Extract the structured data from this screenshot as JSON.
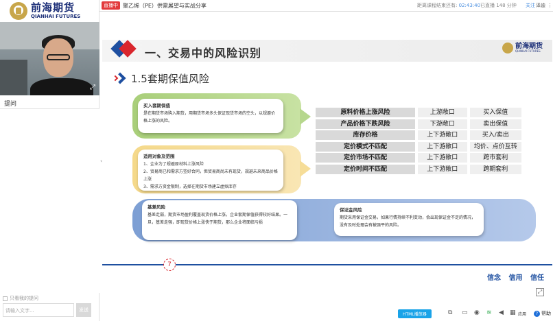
{
  "brand": {
    "cn": "前海期货",
    "en": "QIANHAI FUTURES"
  },
  "left_panel": {
    "ask_tab": "提问",
    "only_mine": "只看我的提问",
    "input_placeholder": "请输入文字...",
    "send": "发送"
  },
  "topbar": {
    "live_badge": "直播中",
    "course_title": "聚乙烯（PE）供需展望与实战分享",
    "countdown_label": "距离课程结束还有:",
    "countdown_time": "02:43:40",
    "played": "已直播 148 分钟",
    "follow": "关注",
    "user": "泽迪"
  },
  "slide": {
    "section_title": "一、交易中的风险识别",
    "subtitle": "1.5套期保值风险",
    "logo": {
      "cn": "前海期货",
      "en": "QIANHAI FUTURES"
    },
    "callout1": {
      "heading": "买入套期保值",
      "body": "是在期货市场购入期货，用期货市场多头保证现货市场的空头，以规避价格上涨的风险。"
    },
    "callout2": {
      "heading": "适用对象及范围",
      "lines": [
        "1、企业为了规避原材料上涨风险",
        "2、贸易商已和需求方签好合同，但贸易商尚未有现货，规避未来商品价格上涨",
        "3、需求方资金限制，选择在期货市场建立虚拟库存"
      ]
    },
    "callout3": {
      "heading": "基差风险",
      "body": "基差走弱，期货市场盈利覆盖现货价格上涨，企业套期保值获得较好结果。一旦，基差走强，即现货价格上涨快于期货，那么企业将面临亏损"
    },
    "callout4": {
      "heading": "保证金风险",
      "body": "期货采用保证金交易，如果行情持续不利变动，会出现保证金不足的情况，没有及时处理会有被强平的风险。"
    },
    "risk_rows": [
      {
        "name": "原料价格上涨风险",
        "exposure": "上游敞口",
        "strategy": "买入保值"
      },
      {
        "name": "产品价格下跌风险",
        "exposure": "下游敞口",
        "strategy": "卖出保值"
      },
      {
        "name": "库存价格",
        "exposure": "上下游敞口",
        "strategy": "买入/卖出"
      },
      {
        "name": "定价模式不匹配",
        "exposure": "上下游敞口",
        "strategy": "均价、点价互转"
      },
      {
        "name": "定价市场不匹配",
        "exposure": "上下游敞口",
        "strategy": "跨市套利"
      },
      {
        "name": "定价时间不匹配",
        "exposure": "上下游敞口",
        "strategy": "跨期套利"
      }
    ],
    "page_number": "7",
    "motto": "信念 信用 信任"
  },
  "bottombar": {
    "html_player": "HTML播放器",
    "app_label": "应用",
    "help": "帮助"
  },
  "colors": {
    "brand_blue": "#1e4fa0",
    "brand_red": "#d9262d",
    "live_red": "#e2393b",
    "accent_blue": "#1aa3e8"
  }
}
